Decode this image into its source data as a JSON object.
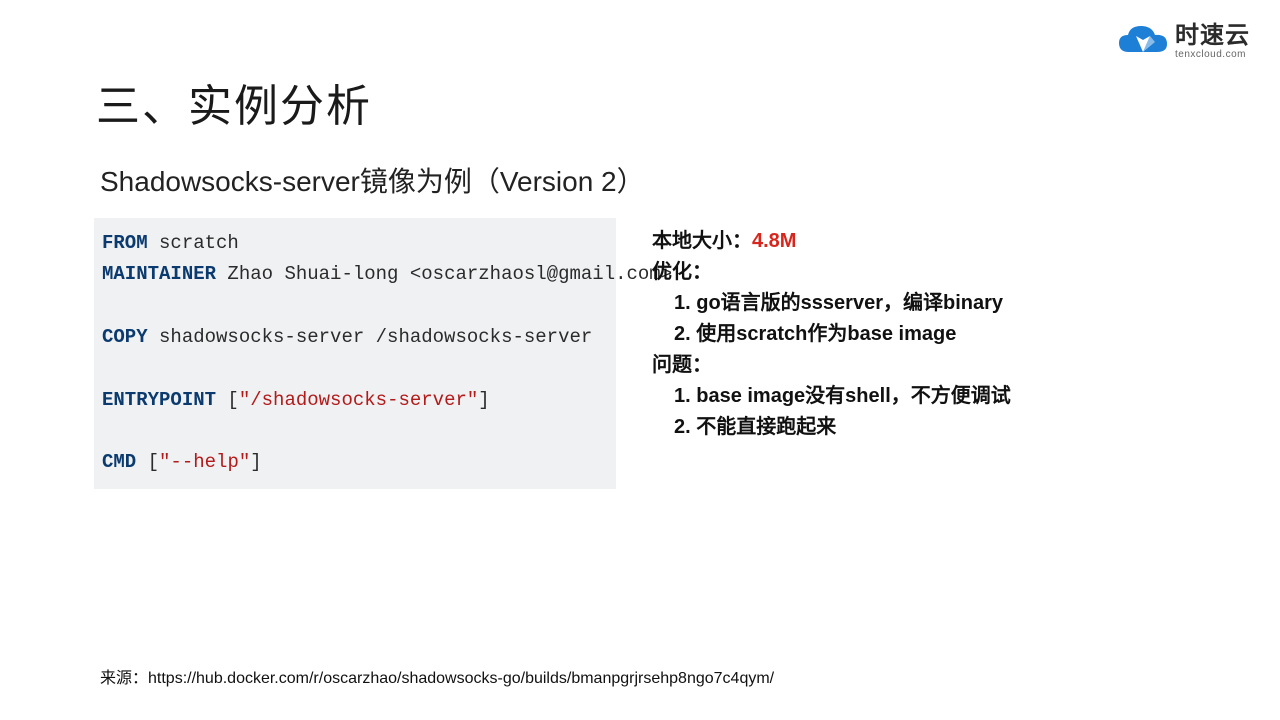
{
  "logo": {
    "name_cn": "时速云",
    "name_en": "tenxcloud.com"
  },
  "title": "三、实例分析",
  "subtitle": "Shadowsocks-server镜像为例（Version 2）",
  "dockerfile": {
    "from_kw": "FROM",
    "from_val": " scratch",
    "maintainer_kw": "MAINTAINER",
    "maintainer_val": " Zhao Shuai-long <oscarzhaosl@gmail.com>",
    "copy_kw": "COPY",
    "copy_val": " shadowsocks-server /shadowsocks-server",
    "entrypoint_kw": "ENTRYPOINT",
    "entrypoint_val": " [",
    "entrypoint_str": "\"/shadowsocks-server\"",
    "entrypoint_close": "]",
    "cmd_kw": "CMD",
    "cmd_val": " [",
    "cmd_str": "\"--help\"",
    "cmd_close": "]"
  },
  "notes": {
    "size_label": "本地大小：",
    "size_value": "4.8M",
    "opt_header": "优化：",
    "opt_1": "1. go语言版的ssserver，编译binary",
    "opt_2": "2. 使用scratch作为base image",
    "issue_header": "问题：",
    "issue_1": "1. base image没有shell，不方便调试",
    "issue_2": "2. 不能直接跑起来"
  },
  "footer": "来源：https://hub.docker.com/r/oscarzhao/shadowsocks-go/builds/bmanpgrjrsehp8ngo7c4qym/"
}
